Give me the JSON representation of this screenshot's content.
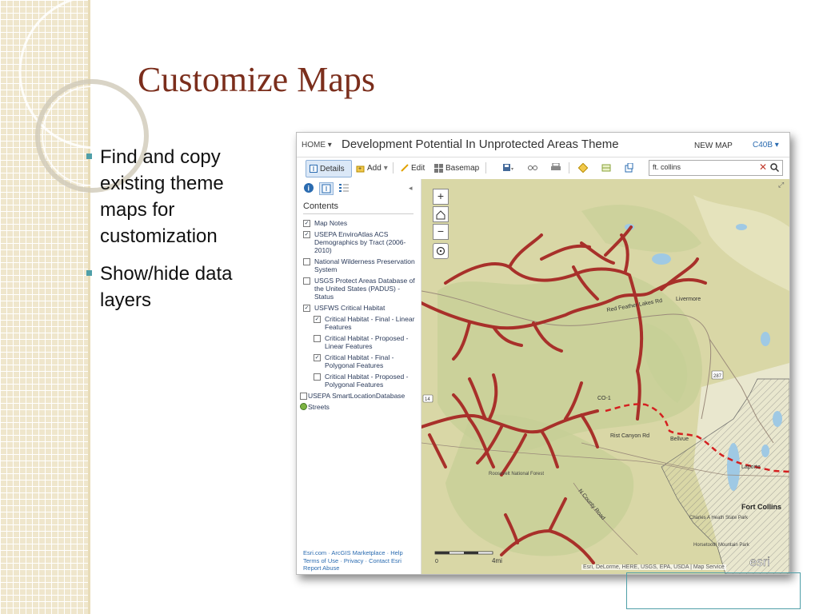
{
  "slide": {
    "title": "Customize Maps",
    "bullets": [
      "Find and copy existing theme maps for customization",
      "Show/hide data layers"
    ],
    "accent_color": "#4f9fa8",
    "title_color": "#7b2e1c"
  },
  "app": {
    "home_label": "HOME",
    "map_title": "Development Potential In Unprotected Areas Theme",
    "new_map_label": "NEW MAP",
    "user_label": "C40B",
    "toolbar": {
      "details": "Details",
      "add": "Add",
      "edit": "Edit",
      "basemap": "Basemap"
    },
    "search_value": "ft. collins",
    "contents_heading": "Contents",
    "layers": [
      {
        "label": "Map Notes",
        "checked": true
      },
      {
        "label": "USEPA EnviroAtlas ACS Demographics by Tract (2006-2010)",
        "checked": true
      },
      {
        "label": "National Wilderness Preservation System",
        "checked": false
      },
      {
        "label": "USGS Protect Areas Database of the United States (PADUS) - Status",
        "checked": false
      },
      {
        "label": "USFWS Critical Habitat",
        "checked": true
      },
      {
        "label": "Critical Habitat - Final - Linear Features",
        "checked": true
      },
      {
        "label": "Critical Habitat - Proposed - Linear Features",
        "checked": false
      },
      {
        "label": "Critical Habitat - Final - Polygonal Features",
        "checked": true
      },
      {
        "label": "Critical Habitat - Proposed - Polygonal Features",
        "checked": false
      },
      {
        "label": "USEPA SmartLocationDatabase",
        "checked": false
      },
      {
        "label": "Streets",
        "checked": null
      }
    ],
    "footer_links": {
      "line1": "Esri.com · ArcGIS Marketplace · Help",
      "line2": "Terms of Use · Privacy · Contact Esri",
      "line3": "Report Abuse"
    }
  },
  "map": {
    "labels": {
      "livermore": "Livermore",
      "roosevelt": "Roosevelt National Forest",
      "bellvue": "Bellvue",
      "laporte": "Laporte",
      "fort_collins": "Fort Collins",
      "charles_a_heath": "Charles A Heath State Park",
      "horsetooth": "Horsetooth Mountain Park",
      "rist_canyon": "Rist Canyon Rd",
      "n_county_road": "N County Road",
      "co1": "CO-1",
      "hwy_14": "14",
      "hwy_287": "287",
      "red_feather": "Red Feather Lakes Rd"
    },
    "scale_label": "4mi",
    "scale_zero": "0",
    "attribution": "Esri, DeLorme, HERE, USGS, EPA, USDA | Map Service",
    "esri_logo": "esri"
  },
  "colors": {
    "habitat_line": "#a8302a",
    "proposed_line": "#d42020",
    "terrain": "#d9d7a6",
    "forest": "#c4cf96",
    "water": "#9fc9e4"
  }
}
